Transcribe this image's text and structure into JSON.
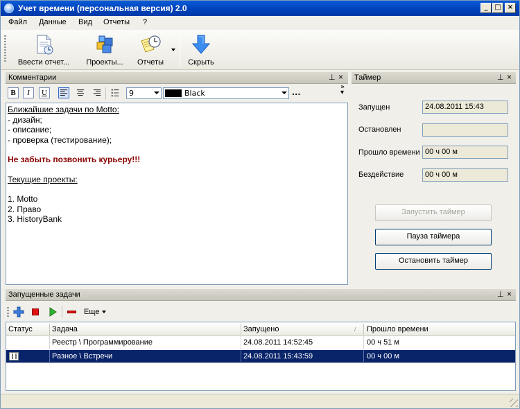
{
  "window": {
    "title": "Учет времени (персональная версия) 2.0",
    "minimize": "_",
    "maximize": "□",
    "close": "×"
  },
  "menu": [
    "Файл",
    "Данные",
    "Вид",
    "Отчеты",
    "?"
  ],
  "toolbar": {
    "enter_report": "Ввести отчет...",
    "projects": "Проекты...",
    "reports": "Отчеты",
    "hide": "Скрыть"
  },
  "comments": {
    "title": "Комментарии",
    "pin": "ᵖ",
    "close": "×",
    "font_size": "9",
    "color_name": "Black",
    "more": "...",
    "bold": "B",
    "italic": "I",
    "underline": "U",
    "lines": [
      "Ближайшие задачи по Motto:",
      "- дизайн;",
      "- описание;",
      "- проверка (тестирование);",
      "Не забыть позвонить курьеру!!!",
      "Текущие проекты:",
      "1. Motto",
      "2. Право",
      "3. HistoryBank"
    ]
  },
  "timer": {
    "title": "Таймер",
    "started_label": "Запущен",
    "started_value": "24.08.2011 15:43",
    "stopped_label": "Остановлен",
    "stopped_value": "",
    "elapsed_label": "Прошло времени",
    "elapsed_value": "00 ч 00 м",
    "idle_label": "Бездействие",
    "idle_value": "00 ч 00 м",
    "start_button": "Запустить таймер",
    "pause_button": "Пауза таймера",
    "stop_button": "Остановить таймер"
  },
  "tasks": {
    "title": "Запущенные задачи",
    "more": "Еще",
    "columns": [
      "Статус",
      "Задача",
      "Запущено",
      "Прошло времени"
    ],
    "rows": [
      {
        "status": "",
        "task": "Реестр \\ Программирование",
        "started": "24.08.2011 14:52:45",
        "elapsed": "00 ч 51 м"
      },
      {
        "status": "pause",
        "task": "Разное \\ Встречи",
        "started": "24.08.2011 15:43:59",
        "elapsed": "00 ч 00 м"
      }
    ]
  }
}
